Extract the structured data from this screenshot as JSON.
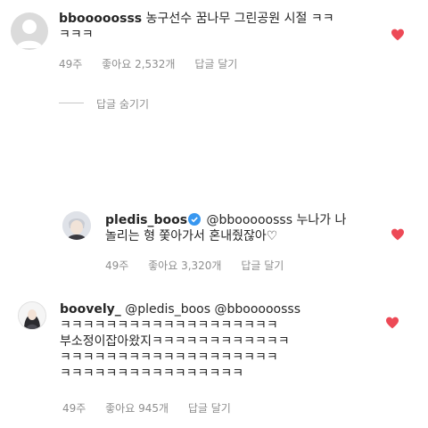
{
  "comments": [
    {
      "username": "bbooooosss",
      "text_line1": "농구선수 꿈나무 그린공원 시절 ㅋㅋ",
      "text_line2": "ㅋㅋㅋ",
      "time": "49주",
      "likes": "좋아요 2,532개",
      "reply_label": "답글 달기",
      "avatar_icon": "default-avatar-icon",
      "like_icon": "heart-filled-icon"
    },
    {
      "username": "pledis_boos",
      "mention": "@bbooooosss",
      "text_line1_rest": "누나가 나",
      "text_line2": "놀리는 형 쫓아가서 혼내줬잖아♡",
      "time": "49주",
      "likes": "좋아요 3,320개",
      "reply_label": "답글 달기",
      "avatar_icon": "profile-photo-avatar",
      "verified_icon": "verified-badge-icon",
      "like_icon": "heart-filled-icon"
    },
    {
      "username": "boovely_",
      "mention1": "@pledis_boos",
      "mention2": "@bbooooosss",
      "text_line2": "ㅋㅋㅋㅋㅋㅋㅋㅋㅋㅋㅋㅋㅋㅋㅋㅋㅋㅋㅋ",
      "text_line3": "부소정이잡아왔지ㅋㅋㅋㅋㅋㅋㅋㅋㅋㅋㅋㅋ",
      "text_line4": "ㅋㅋㅋㅋㅋㅋㅋㅋㅋㅋㅋㅋㅋㅋㅋㅋㅋㅋㅋ",
      "text_line5": "ㅋㅋㅋㅋㅋㅋㅋㅋㅋㅋㅋㅋㅋㅋㅋㅋ",
      "time": "49주",
      "likes": "좋아요 945개",
      "reply_label": "답글 달기",
      "avatar_icon": "profile-photo-avatar",
      "like_icon": "heart-filled-icon"
    }
  ],
  "hide_replies_label": "답글 숨기기",
  "colors": {
    "heart": "#ed4956",
    "meta_text": "#8e8e8e",
    "verified": "#3897f0",
    "text": "#262626"
  }
}
